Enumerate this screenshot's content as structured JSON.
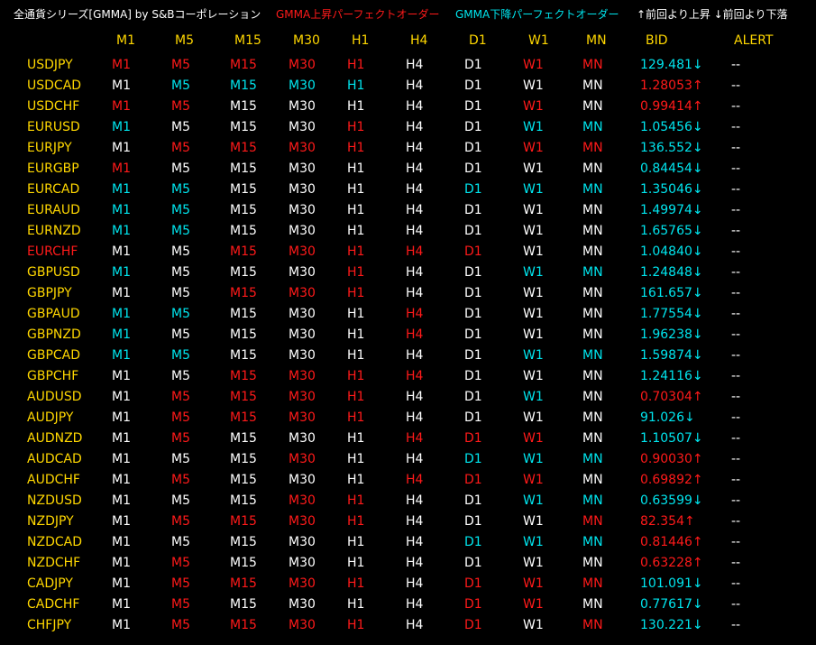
{
  "colors": {
    "white": "#ffffff",
    "red": "#ff1a1a",
    "cyan": "#00e5ee",
    "yellow": "#ffd700"
  },
  "header": {
    "title": "全通貨シリーズ[GMMA] by S&Bコーポレーション",
    "legend_up": "GMMA上昇パーフェクトオーダー",
    "legend_down": "GMMA下降パーフェクトオーダー",
    "arrow_note": "↑前回より上昇 ↓前回より下落"
  },
  "columns": [
    "M1",
    "M5",
    "M15",
    "M30",
    "H1",
    "H4",
    "D1",
    "W1",
    "MN",
    "BID",
    "ALERT"
  ],
  "rows": [
    {
      "pair": "USDJPY",
      "pair_color": "y",
      "tf": [
        "r",
        "r",
        "r",
        "r",
        "r",
        "w",
        "w",
        "r",
        "r"
      ],
      "bid": "129.481↓",
      "bid_color": "c",
      "alert": "--"
    },
    {
      "pair": "USDCAD",
      "pair_color": "y",
      "tf": [
        "w",
        "c",
        "c",
        "c",
        "c",
        "w",
        "w",
        "w",
        "w"
      ],
      "bid": "1.28053↑",
      "bid_color": "r",
      "alert": "--"
    },
    {
      "pair": "USDCHF",
      "pair_color": "y",
      "tf": [
        "r",
        "r",
        "w",
        "w",
        "w",
        "w",
        "w",
        "r",
        "w"
      ],
      "bid": "0.99414↑",
      "bid_color": "r",
      "alert": "--"
    },
    {
      "pair": "EURUSD",
      "pair_color": "y",
      "tf": [
        "c",
        "w",
        "w",
        "w",
        "r",
        "w",
        "w",
        "c",
        "c"
      ],
      "bid": "1.05456↓",
      "bid_color": "c",
      "alert": "--"
    },
    {
      "pair": "EURJPY",
      "pair_color": "y",
      "tf": [
        "w",
        "r",
        "r",
        "r",
        "r",
        "w",
        "w",
        "r",
        "r"
      ],
      "bid": "136.552↓",
      "bid_color": "c",
      "alert": "--"
    },
    {
      "pair": "EURGBP",
      "pair_color": "y",
      "tf": [
        "r",
        "w",
        "w",
        "w",
        "w",
        "w",
        "w",
        "w",
        "w"
      ],
      "bid": "0.84454↓",
      "bid_color": "c",
      "alert": "--"
    },
    {
      "pair": "EURCAD",
      "pair_color": "y",
      "tf": [
        "c",
        "c",
        "w",
        "w",
        "w",
        "w",
        "c",
        "c",
        "c"
      ],
      "bid": "1.35046↓",
      "bid_color": "c",
      "alert": "--"
    },
    {
      "pair": "EURAUD",
      "pair_color": "y",
      "tf": [
        "c",
        "c",
        "w",
        "w",
        "w",
        "w",
        "w",
        "w",
        "w"
      ],
      "bid": "1.49974↓",
      "bid_color": "c",
      "alert": "--"
    },
    {
      "pair": "EURNZD",
      "pair_color": "y",
      "tf": [
        "c",
        "c",
        "w",
        "w",
        "w",
        "w",
        "w",
        "w",
        "w"
      ],
      "bid": "1.65765↓",
      "bid_color": "c",
      "alert": "--"
    },
    {
      "pair": "EURCHF",
      "pair_color": "r",
      "tf": [
        "w",
        "w",
        "r",
        "r",
        "r",
        "r",
        "r",
        "w",
        "w"
      ],
      "bid": "1.04840↓",
      "bid_color": "c",
      "alert": "--"
    },
    {
      "pair": "GBPUSD",
      "pair_color": "y",
      "tf": [
        "c",
        "w",
        "w",
        "w",
        "r",
        "w",
        "w",
        "c",
        "c"
      ],
      "bid": "1.24848↓",
      "bid_color": "c",
      "alert": "--"
    },
    {
      "pair": "GBPJPY",
      "pair_color": "y",
      "tf": [
        "w",
        "w",
        "r",
        "r",
        "r",
        "w",
        "w",
        "w",
        "w"
      ],
      "bid": "161.657↓",
      "bid_color": "c",
      "alert": "--"
    },
    {
      "pair": "GBPAUD",
      "pair_color": "y",
      "tf": [
        "c",
        "c",
        "w",
        "w",
        "w",
        "r",
        "w",
        "w",
        "w"
      ],
      "bid": "1.77554↓",
      "bid_color": "c",
      "alert": "--"
    },
    {
      "pair": "GBPNZD",
      "pair_color": "y",
      "tf": [
        "c",
        "w",
        "w",
        "w",
        "w",
        "r",
        "w",
        "w",
        "w"
      ],
      "bid": "1.96238↓",
      "bid_color": "c",
      "alert": "--"
    },
    {
      "pair": "GBPCAD",
      "pair_color": "y",
      "tf": [
        "c",
        "c",
        "w",
        "w",
        "w",
        "w",
        "w",
        "c",
        "c"
      ],
      "bid": "1.59874↓",
      "bid_color": "c",
      "alert": "--"
    },
    {
      "pair": "GBPCHF",
      "pair_color": "y",
      "tf": [
        "w",
        "w",
        "r",
        "r",
        "r",
        "r",
        "w",
        "w",
        "w"
      ],
      "bid": "1.24116↓",
      "bid_color": "c",
      "alert": "--"
    },
    {
      "pair": "AUDUSD",
      "pair_color": "y",
      "tf": [
        "w",
        "r",
        "r",
        "r",
        "r",
        "w",
        "w",
        "c",
        "w"
      ],
      "bid": "0.70304↑",
      "bid_color": "r",
      "alert": "--"
    },
    {
      "pair": "AUDJPY",
      "pair_color": "y",
      "tf": [
        "w",
        "r",
        "r",
        "r",
        "r",
        "w",
        "w",
        "w",
        "w"
      ],
      "bid": "91.026↓",
      "bid_color": "c",
      "alert": "--"
    },
    {
      "pair": "AUDNZD",
      "pair_color": "y",
      "tf": [
        "w",
        "r",
        "w",
        "w",
        "w",
        "r",
        "r",
        "r",
        "w"
      ],
      "bid": "1.10507↓",
      "bid_color": "c",
      "alert": "--"
    },
    {
      "pair": "AUDCAD",
      "pair_color": "y",
      "tf": [
        "w",
        "w",
        "w",
        "r",
        "w",
        "w",
        "c",
        "c",
        "c"
      ],
      "bid": "0.90030↑",
      "bid_color": "r",
      "alert": "--"
    },
    {
      "pair": "AUDCHF",
      "pair_color": "y",
      "tf": [
        "w",
        "r",
        "w",
        "w",
        "w",
        "r",
        "r",
        "r",
        "w"
      ],
      "bid": "0.69892↑",
      "bid_color": "r",
      "alert": "--"
    },
    {
      "pair": "NZDUSD",
      "pair_color": "y",
      "tf": [
        "w",
        "w",
        "w",
        "r",
        "r",
        "w",
        "w",
        "c",
        "c"
      ],
      "bid": "0.63599↓",
      "bid_color": "c",
      "alert": "--"
    },
    {
      "pair": "NZDJPY",
      "pair_color": "y",
      "tf": [
        "w",
        "r",
        "r",
        "r",
        "r",
        "w",
        "w",
        "w",
        "r"
      ],
      "bid": "82.354↑",
      "bid_color": "r",
      "alert": "--"
    },
    {
      "pair": "NZDCAD",
      "pair_color": "y",
      "tf": [
        "w",
        "w",
        "w",
        "w",
        "w",
        "w",
        "c",
        "c",
        "c"
      ],
      "bid": "0.81446↑",
      "bid_color": "r",
      "alert": "--"
    },
    {
      "pair": "NZDCHF",
      "pair_color": "y",
      "tf": [
        "w",
        "r",
        "w",
        "w",
        "w",
        "w",
        "w",
        "w",
        "w"
      ],
      "bid": "0.63228↑",
      "bid_color": "r",
      "alert": "--"
    },
    {
      "pair": "CADJPY",
      "pair_color": "y",
      "tf": [
        "w",
        "r",
        "r",
        "r",
        "r",
        "w",
        "r",
        "r",
        "r"
      ],
      "bid": "101.091↓",
      "bid_color": "c",
      "alert": "--"
    },
    {
      "pair": "CADCHF",
      "pair_color": "y",
      "tf": [
        "w",
        "r",
        "w",
        "w",
        "w",
        "w",
        "r",
        "r",
        "w"
      ],
      "bid": "0.77617↓",
      "bid_color": "c",
      "alert": "--"
    },
    {
      "pair": "CHFJPY",
      "pair_color": "y",
      "tf": [
        "w",
        "r",
        "r",
        "r",
        "r",
        "w",
        "r",
        "w",
        "r"
      ],
      "bid": "130.221↓",
      "bid_color": "c",
      "alert": "--"
    }
  ]
}
